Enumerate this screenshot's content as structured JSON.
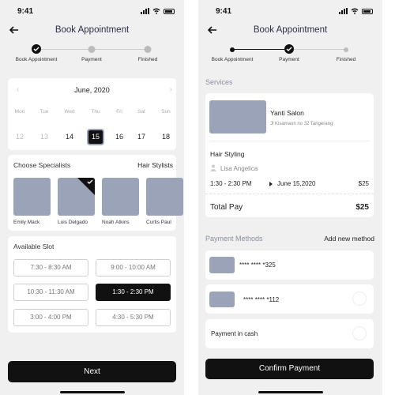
{
  "status": {
    "time": "9:41"
  },
  "left": {
    "title": "Book Appointment",
    "steps": [
      "Book Appointment",
      "Payment",
      "Finished"
    ],
    "calendar": {
      "month": "June, 2020",
      "weekdays": [
        "Mon",
        "Tue",
        "Wed",
        "Thu",
        "Fri",
        "Sat",
        "Sun"
      ],
      "dates": [
        "12",
        "13",
        "14",
        "15",
        "16",
        "17",
        "18"
      ],
      "selected": "15"
    },
    "specialists": {
      "label": "Choose Specialists",
      "filter": "Hair Stylists",
      "people": [
        "Emily Mack",
        "Luis Delgado",
        "Noah Atkins",
        "Curtis Paul"
      ]
    },
    "slots": {
      "label": "Available Slot",
      "items": [
        "7:30 - 8:30 AM",
        "9:00 - 10:00 AM",
        "10:30 - 11:30 AM",
        "1:30 - 2:30 PM",
        "3:00 - 4:00 PM",
        "4:30 - 5:30 PM"
      ]
    },
    "next": "Next"
  },
  "right": {
    "title": "Book Appointment",
    "steps": [
      "Book Appointment",
      "Payment",
      "Finished"
    ],
    "services_label": "Services",
    "salon": {
      "name": "Yanti Salon",
      "address": "Jl Kisamaun no 32 Tangerang"
    },
    "service": {
      "name": "Hair Styling",
      "stylist": "Lisa Angelica",
      "time": "1:30 - 2:30 PM",
      "date": "June 15,2020",
      "price": "$25"
    },
    "total": {
      "label": "Total Pay",
      "value": "$25"
    },
    "payment": {
      "label": "Payment Methods",
      "add": "Add new method",
      "cards": [
        "**** **** *325",
        "**** **** *112"
      ],
      "cash": "Payment in cash"
    },
    "confirm": "Confirm Payment"
  },
  "colors": {
    "accent": "#111111",
    "placeholder": "#9aa3b8",
    "background": "#f0f0f0"
  }
}
